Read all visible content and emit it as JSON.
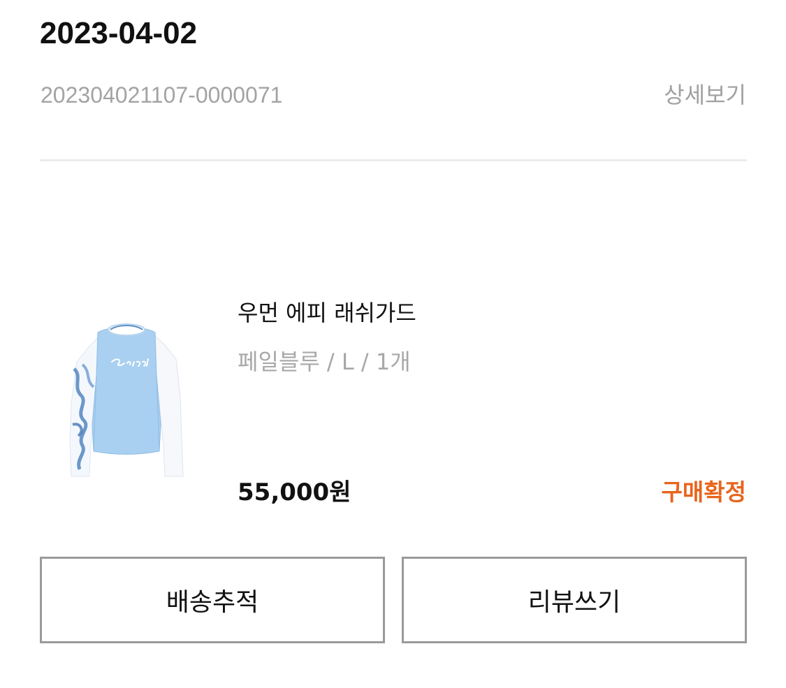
{
  "order": {
    "date": "2023-04-02",
    "number": "202304021107-0000071",
    "detail_label": "상세보기"
  },
  "product": {
    "name": "우먼 에피 래쉬가드",
    "option": "페일블루 / L / 1개",
    "price": "55,000원",
    "status": "구매확정",
    "status_color": "#e8641c",
    "image_logo_text": "Barrel",
    "image_color": "#a9d0f0"
  },
  "actions": {
    "track_label": "배송추적",
    "review_label": "리뷰쓰기"
  }
}
